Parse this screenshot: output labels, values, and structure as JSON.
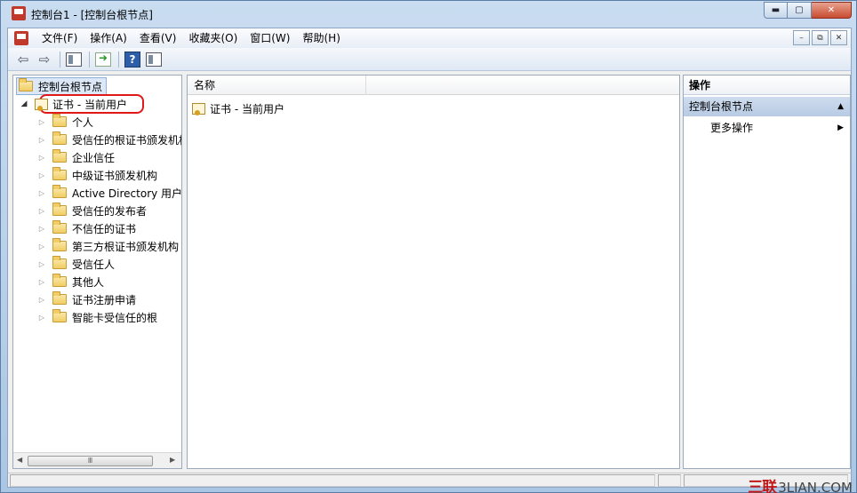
{
  "window": {
    "title": "控制台1 - [控制台根节点]",
    "caption": {
      "minimize": "▬",
      "maximize": "▢",
      "close": "✕"
    }
  },
  "menubar": {
    "items": [
      "文件(F)",
      "操作(A)",
      "查看(V)",
      "收藏夹(O)",
      "窗口(W)",
      "帮助(H)"
    ],
    "mdi": {
      "minimize": "–",
      "restore": "⧉",
      "close": "✕"
    }
  },
  "toolbar": {
    "icons": [
      "back-arrow-icon",
      "forward-arrow-icon",
      "show-hide-tree-icon",
      "export-list-icon",
      "help-icon",
      "show-hide-action-pane-icon"
    ],
    "help_glyph": "?"
  },
  "tree": {
    "root_label": "控制台根节点",
    "cert_node_label": "证书 - 当前用户",
    "children": [
      "个人",
      "受信任的根证书颁发机构",
      "企业信任",
      "中级证书颁发机构",
      "Active Directory 用户对象",
      "受信任的发布者",
      "不信任的证书",
      "第三方根证书颁发机构",
      "受信任人",
      "其他人",
      "证书注册申请",
      "智能卡受信任的根"
    ],
    "scroll_thumb_glyph": "Ⅲ"
  },
  "list": {
    "column_name": "名称",
    "rows": [
      "证书 - 当前用户"
    ]
  },
  "actions": {
    "title": "操作",
    "group_label": "控制台根节点",
    "items": [
      "更多操作"
    ]
  },
  "watermark": {
    "cn": "三联",
    "en": "3LIAN.COM"
  },
  "colors": {
    "highlight_circle": "#e01818",
    "action_group_bg": "#b7cbe4"
  }
}
